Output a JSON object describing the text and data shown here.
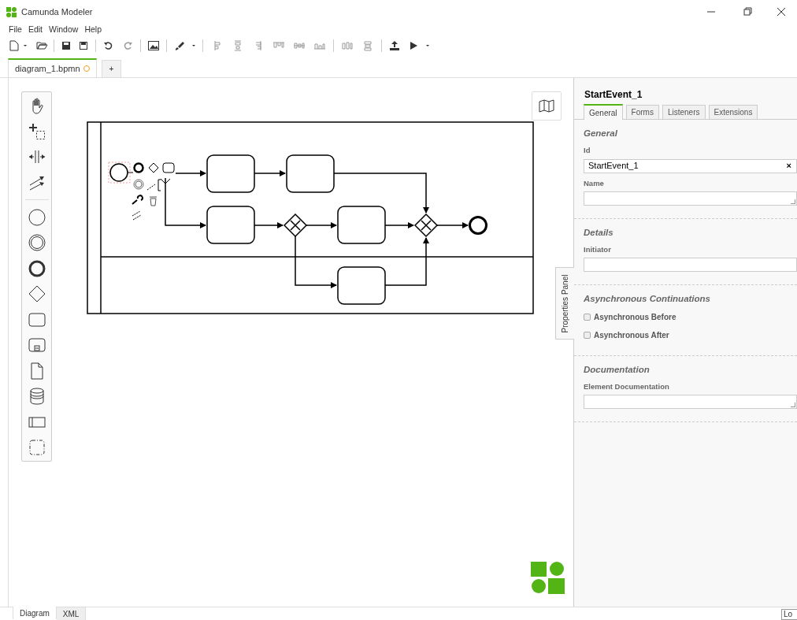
{
  "window": {
    "title": "Camunda Modeler"
  },
  "menu": [
    "File",
    "Edit",
    "Window",
    "Help"
  ],
  "file_tabs": [
    {
      "label": "diagram_1.bpmn",
      "selected": true,
      "unsaved": true
    },
    {
      "label": "+",
      "selected": false,
      "unsaved": false
    }
  ],
  "properties_panel": {
    "toggle_label": "Properties Panel",
    "title": "StartEvent_1",
    "tabs": [
      {
        "label": "General",
        "selected": true
      },
      {
        "label": "Forms",
        "selected": false
      },
      {
        "label": "Listeners",
        "selected": false
      },
      {
        "label": "Extensions",
        "selected": false
      }
    ],
    "sections": [
      {
        "title": "General",
        "fields": [
          {
            "kind": "text",
            "label": "Id",
            "value": "StartEvent_1",
            "clear": "×"
          },
          {
            "kind": "textarea",
            "label": "Name"
          }
        ]
      },
      {
        "title": "Details",
        "fields": [
          {
            "kind": "text",
            "label": "Initiator"
          }
        ]
      },
      {
        "title": "Asynchronous Continuations",
        "fields": [
          {
            "kind": "checkbox",
            "label": "Asynchronous Before",
            "checked": false
          },
          {
            "kind": "checkbox",
            "label": "Asynchronous After",
            "checked": false
          }
        ]
      },
      {
        "title": "Documentation",
        "fields": [
          {
            "kind": "textarea",
            "label": "Element Documentation"
          }
        ]
      }
    ]
  },
  "view_tabs": [
    {
      "label": "Diagram",
      "selected": true
    },
    {
      "label": "XML",
      "selected": false
    }
  ],
  "log_button": {
    "label": "Lo"
  }
}
